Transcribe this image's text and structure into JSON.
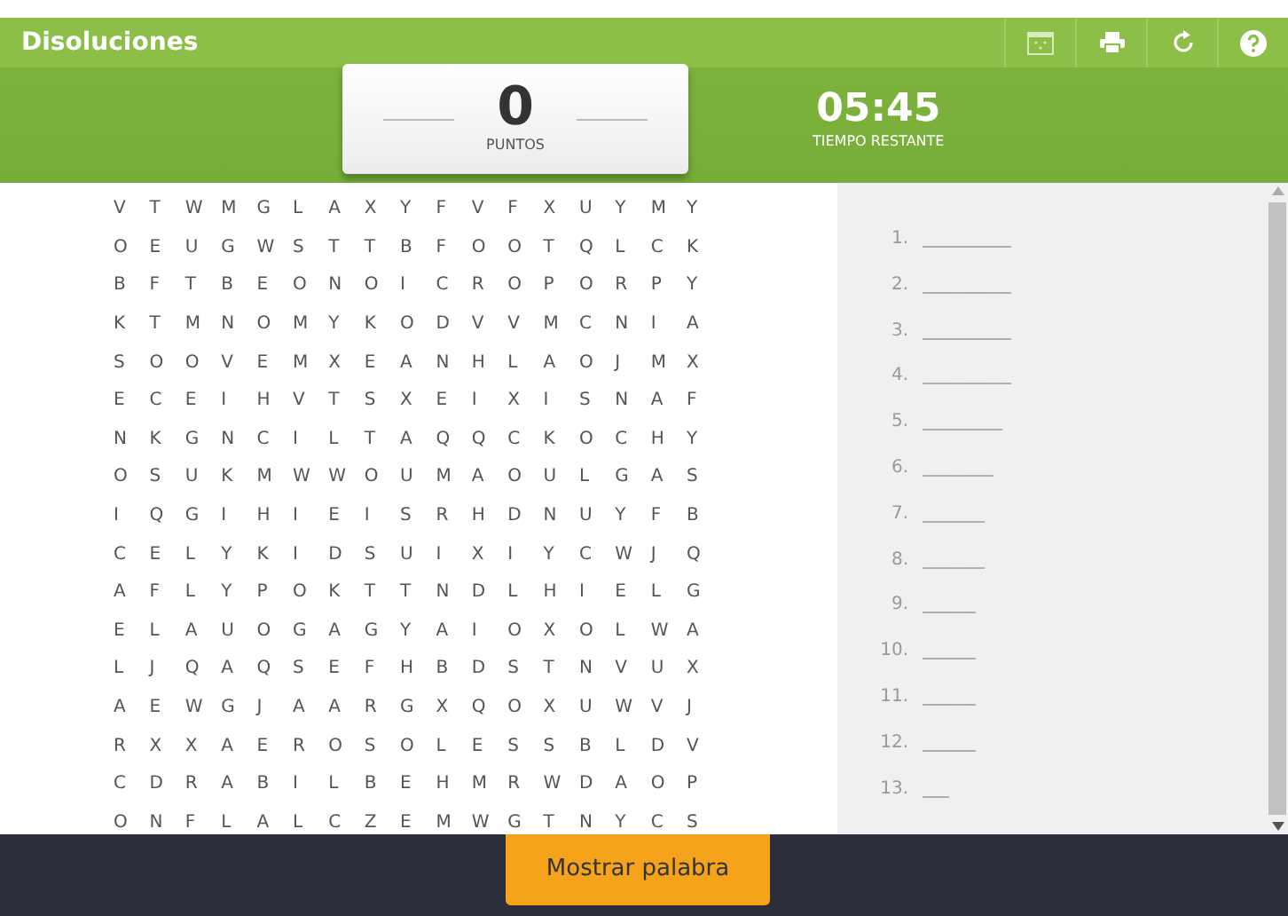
{
  "title": "Disoluciones",
  "score": {
    "value": "0",
    "label": "PUNTOS"
  },
  "timer": {
    "value": "05:45",
    "label": "TIEMPO RESTANTE"
  },
  "grid": [
    [
      "V",
      "T",
      "W",
      "M",
      "G",
      "L",
      "A",
      "X",
      "Y",
      "F",
      "V",
      "F",
      "X",
      "U",
      "Y",
      "M",
      "Y"
    ],
    [
      "O",
      "E",
      "U",
      "G",
      "W",
      "S",
      "T",
      "T",
      "B",
      "F",
      "O",
      "O",
      "T",
      "Q",
      "L",
      "C",
      "K"
    ],
    [
      "B",
      "F",
      "T",
      "B",
      "E",
      "O",
      "N",
      "O",
      "I",
      "C",
      "R",
      "O",
      "P",
      "O",
      "R",
      "P",
      "Y"
    ],
    [
      "K",
      "T",
      "M",
      "N",
      "O",
      "M",
      "Y",
      "K",
      "O",
      "D",
      "V",
      "V",
      "M",
      "C",
      "N",
      "I",
      "A"
    ],
    [
      "S",
      "O",
      "O",
      "V",
      "E",
      "M",
      "X",
      "E",
      "A",
      "N",
      "H",
      "L",
      "A",
      "O",
      "J",
      "M",
      "X"
    ],
    [
      "E",
      "C",
      "E",
      "I",
      "H",
      "V",
      "T",
      "S",
      "X",
      "E",
      "I",
      "X",
      "I",
      "S",
      "N",
      "A",
      "F"
    ],
    [
      "N",
      "K",
      "G",
      "N",
      "C",
      "I",
      "L",
      "T",
      "A",
      "Q",
      "Q",
      "C",
      "K",
      "O",
      "C",
      "H",
      "Y"
    ],
    [
      "O",
      "S",
      "U",
      "K",
      "M",
      "W",
      "W",
      "O",
      "U",
      "M",
      "A",
      "O",
      "U",
      "L",
      "G",
      "A",
      "S"
    ],
    [
      "I",
      "Q",
      "G",
      "I",
      "H",
      "I",
      "E",
      "I",
      "S",
      "R",
      "H",
      "D",
      "N",
      "U",
      "Y",
      "F",
      "B"
    ],
    [
      "C",
      "E",
      "L",
      "Y",
      "K",
      "I",
      "D",
      "S",
      "U",
      "I",
      "X",
      "I",
      "Y",
      "C",
      "W",
      "J",
      "Q"
    ],
    [
      "A",
      "F",
      "L",
      "Y",
      "P",
      "O",
      "K",
      "T",
      "T",
      "N",
      "D",
      "L",
      "H",
      "I",
      "E",
      "L",
      "G"
    ],
    [
      "E",
      "L",
      "A",
      "U",
      "O",
      "G",
      "A",
      "G",
      "Y",
      "A",
      "I",
      "O",
      "X",
      "O",
      "L",
      "W",
      "A"
    ],
    [
      "L",
      "J",
      "Q",
      "A",
      "Q",
      "S",
      "E",
      "F",
      "H",
      "B",
      "D",
      "S",
      "T",
      "N",
      "V",
      "U",
      "X"
    ],
    [
      "A",
      "E",
      "W",
      "G",
      "J",
      "A",
      "A",
      "R",
      "G",
      "X",
      "Q",
      "O",
      "X",
      "U",
      "W",
      "V",
      "J"
    ],
    [
      "R",
      "X",
      "X",
      "A",
      "E",
      "R",
      "O",
      "S",
      "O",
      "L",
      "E",
      "S",
      "S",
      "B",
      "L",
      "D",
      "V"
    ],
    [
      "C",
      "D",
      "R",
      "A",
      "B",
      "I",
      "L",
      "B",
      "E",
      "H",
      "M",
      "R",
      "W",
      "D",
      "A",
      "O",
      "P"
    ],
    [
      "O",
      "N",
      "F",
      "L",
      "A",
      "L",
      "C",
      "Z",
      "E",
      "M",
      "W",
      "G",
      "T",
      "N",
      "Y",
      "C",
      "S"
    ]
  ],
  "words": [
    {
      "number": "1.",
      "blank": "__________"
    },
    {
      "number": "2.",
      "blank": "__________"
    },
    {
      "number": "3.",
      "blank": "__________"
    },
    {
      "number": "4.",
      "blank": "__________"
    },
    {
      "number": "5.",
      "blank": "_________"
    },
    {
      "number": "6.",
      "blank": "________"
    },
    {
      "number": "7.",
      "blank": "_______"
    },
    {
      "number": "8.",
      "blank": "_______"
    },
    {
      "number": "9.",
      "blank": "______"
    },
    {
      "number": "10.",
      "blank": "______"
    },
    {
      "number": "11.",
      "blank": "______"
    },
    {
      "number": "12.",
      "blank": "______"
    },
    {
      "number": "13.",
      "blank": "___"
    }
  ],
  "button": "Mostrar palabra"
}
